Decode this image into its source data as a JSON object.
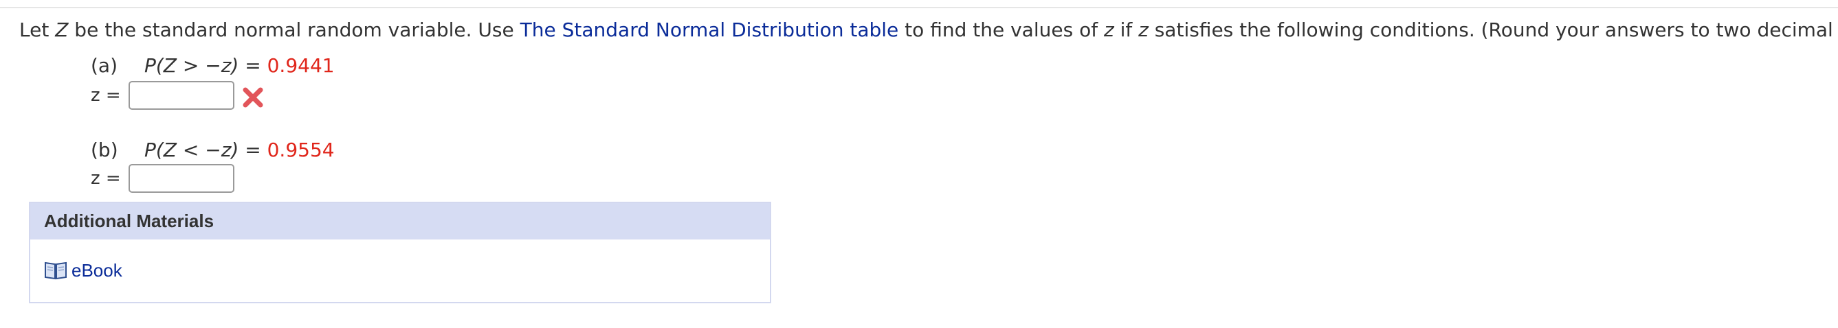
{
  "question": {
    "intro_1": "Let ",
    "intro_var": "Z",
    "intro_2": " be the standard normal random variable. Use ",
    "link_text": "The Standard Normal Distribution table",
    "intro_3": " to find the values of ",
    "var_z1": "z",
    "intro_4": " if ",
    "var_z2": "z",
    "intro_5": " satisfies the following conditions. (Round your answers to two decimal places.)"
  },
  "parts": [
    {
      "label": "(a)",
      "prob_expr": "P(Z > −z) = ",
      "prob_value": "0.9441",
      "answer_label": "z =",
      "answer_value": "",
      "status": "incorrect"
    },
    {
      "label": "(b)",
      "prob_expr": "P(Z < −z) = ",
      "prob_value": "0.9554",
      "answer_label": "z =",
      "answer_value": "",
      "status": "none"
    }
  ],
  "additional_materials": {
    "header": "Additional Materials",
    "items": [
      {
        "label": "eBook",
        "icon": "book-icon"
      }
    ]
  },
  "colors": {
    "link": "#0b2c99",
    "value_red": "#e0261b",
    "error_mark": "#e2555a",
    "panel_header_bg": "#d6dcf3"
  }
}
